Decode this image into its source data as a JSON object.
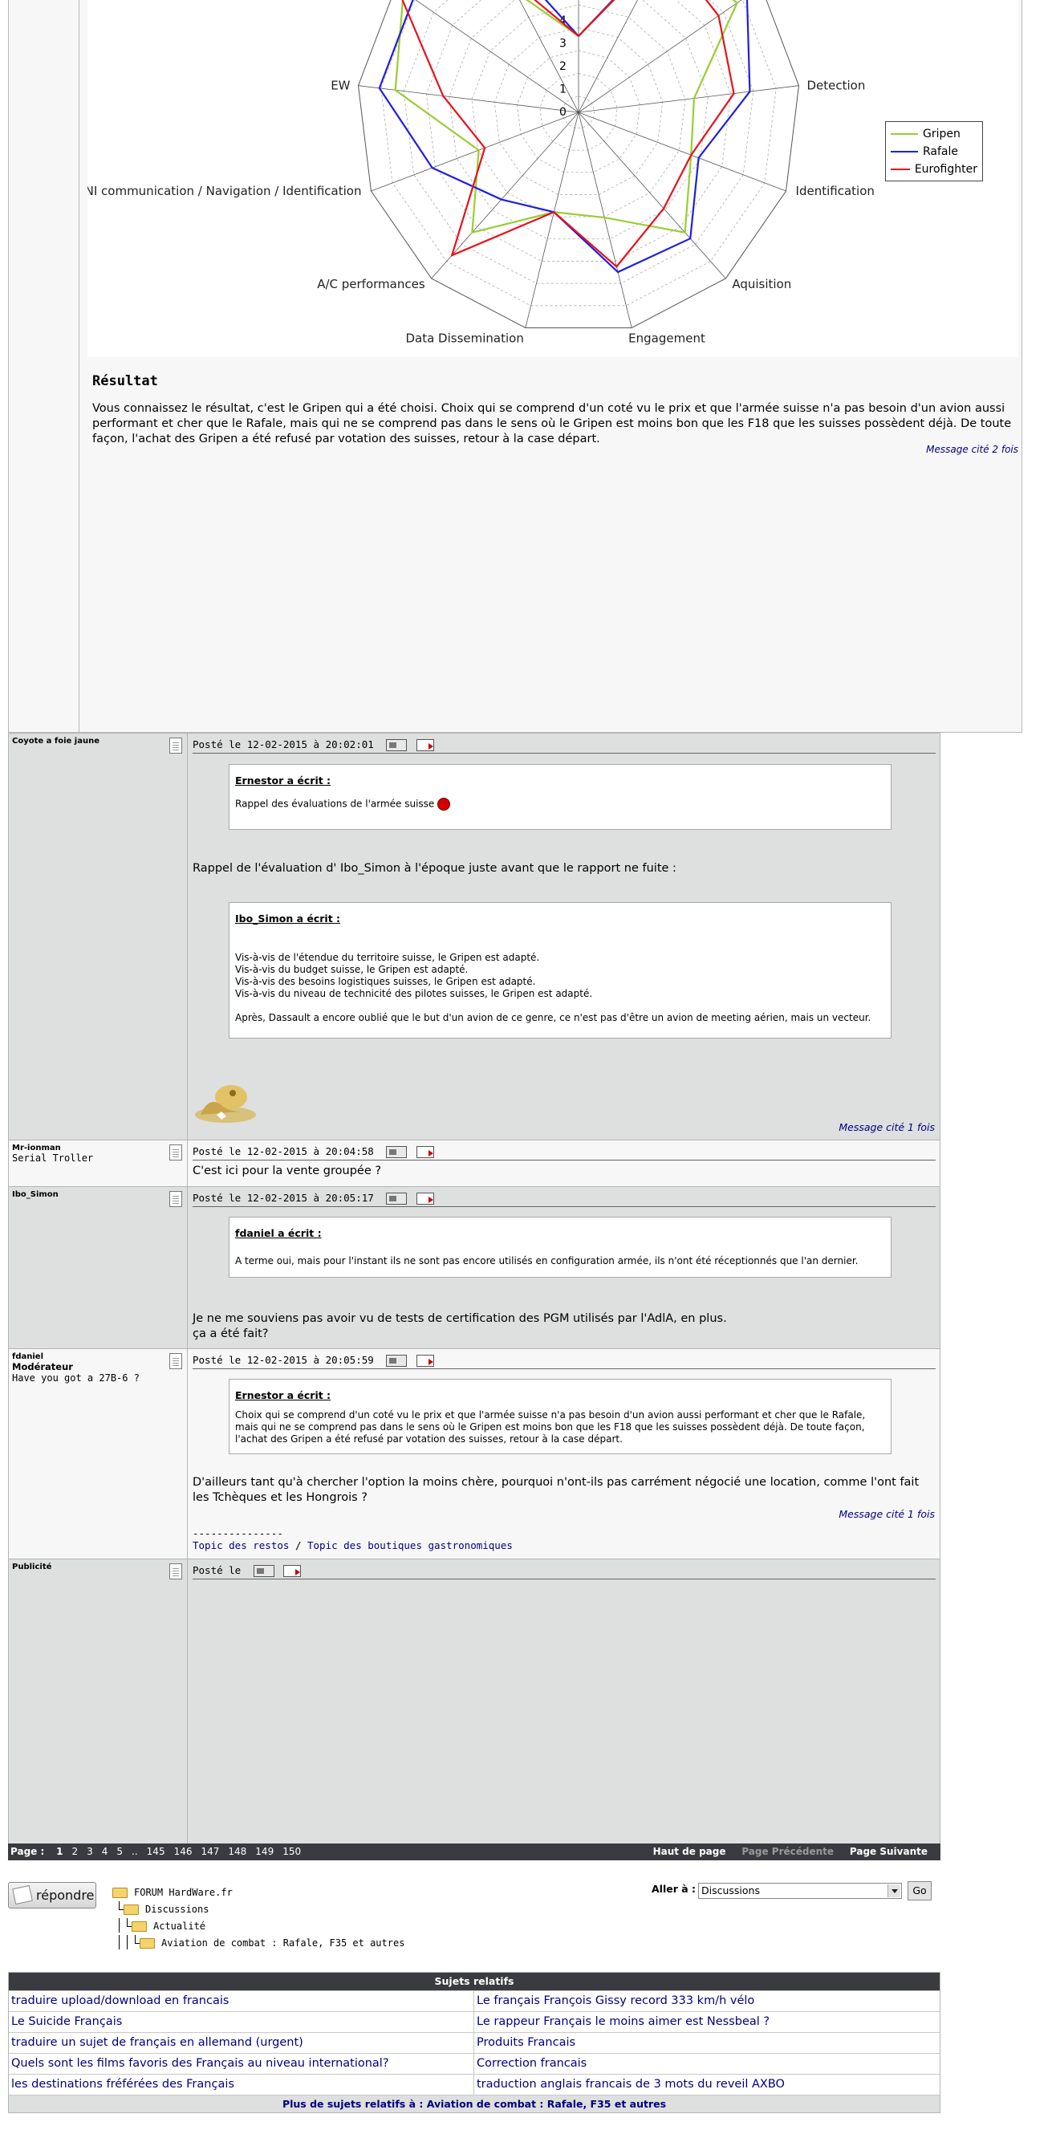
{
  "colors": {
    "gripen": "#9acd32",
    "rafale": "#1f1fdd",
    "eurofighter": "#e8121a",
    "bar_dark": "#393b40",
    "link": "#000080"
  },
  "chart_data": {
    "type": "radar",
    "axes": [
      "Detection",
      "Identification",
      "Aquisition",
      "Engagement",
      "Data Dissemination",
      "A/C performances",
      "CNI communication / Navigation / Identification",
      "EW"
    ],
    "tick_labels": [
      "0",
      "1",
      "2",
      "3",
      "4"
    ],
    "series": [
      {
        "name": "Gripen"
      },
      {
        "name": "Rafale"
      },
      {
        "name": "Eurofighter"
      }
    ]
  },
  "top_post": {
    "result_title": "Résultat",
    "result_text": "Vous connaissez le résultat, c'est le Gripen qui a été choisi. Choix qui se comprend d'un coté vu le prix et que l'armée suisse n'a pas besoin d'un avion aussi performant et cher que le Rafale, mais qui ne se comprend pas dans le sens où le Gripen est moins bon que les F18 que les suisses possèdent déjà. De toute façon, l'achat des Gripen a été refusé par votation des suisses, retour à la case départ.",
    "cited": "Message cité 2 fois"
  },
  "posts": [
    {
      "author": "Coyote a foie jaune",
      "date": "Posté le 12-02-2015 à 20:02:01",
      "quote1_title": "Ernestor a écrit :",
      "quote1_text": "Rappel des évaluations de l'armée suisse",
      "text": "Rappel de l'évaluation d' Ibo_Simon à l'époque juste avant que le rapport ne fuite :",
      "quote2_title": "Ibo_Simon a écrit :",
      "quote2_lines": [
        "Vis-à-vis de l'étendue du territoire suisse, le Gripen est adapté.",
        "Vis-à-vis du budget suisse, le Gripen est adapté.",
        "Vis-à-vis des besoins logistiques suisses, le Gripen est adapté.",
        "Vis-à-vis du niveau de technicité des pilotes suisses, le Gripen est adapté.",
        "",
        "Après, Dassault a encore oublié que le but d'un avion de ce genre, ce n'est pas d'être un avion de meeting aérien, mais un vecteur."
      ],
      "cited": "Message cité 1 fois"
    },
    {
      "author": "Mr-ionman",
      "title": "Serial Troller",
      "date": "Posté le 12-02-2015 à 20:04:58",
      "text": "C'est ici pour la vente groupée ?"
    },
    {
      "author": "Ibo_Simon",
      "date": "Posté le 12-02-2015 à 20:05:17",
      "quote_title": "fdaniel a écrit :",
      "quote_text": "A terme oui, mais pour l'instant ils ne sont pas encore utilisés en configuration armée, ils n'ont été réceptionnés que l'an dernier.",
      "text_line1": "Je ne me souviens pas avoir vu de tests de certification des PGM utilisés par l'AdlA, en plus.",
      "text_line2": "ça a été fait?"
    },
    {
      "author": "fdaniel",
      "rank": "Modérateur",
      "title": "Have you got a 27B-6 ?",
      "date": "Posté le 12-02-2015 à 20:05:59",
      "quote_title": "Ernestor a écrit :",
      "quote_text": "Choix qui se comprend d'un coté vu le prix et que l'armée suisse n'a pas besoin d'un avion aussi performant et cher que le Rafale, mais qui ne se comprend pas dans le sens où le Gripen est moins bon que les F18 que les suisses possèdent déjà. De toute façon, l'achat des Gripen a été refusé par votation des suisses, retour à la case départ.",
      "text": "D'ailleurs tant qu'à chercher l'option la moins chère, pourquoi n'ont-ils pas carrément négocié une location, comme l'ont fait les Tchèques et les Hongrois ?",
      "cited": "Message cité 1 fois",
      "sig_sep": "---------------",
      "sig_link1": "Topic des restos",
      "sig_slash": " / ",
      "sig_link2": "Topic des boutiques gastronomiques"
    },
    {
      "author": "Publicité",
      "date": "Posté le"
    }
  ],
  "pager": {
    "label": "Page :",
    "pages": [
      "1",
      "2",
      "3",
      "4",
      "5",
      "..",
      "145",
      "146",
      "147",
      "148",
      "149",
      "150"
    ],
    "current": "1",
    "top_link": "Haut de page",
    "prev_link": "Page Précédente",
    "next_link": "Page Suivante"
  },
  "reply_label": "répondre",
  "breadcrumb": [
    "FORUM HardWare.fr",
    "Discussions",
    "Actualité",
    "Aviation de combat : Rafale, F35 et autres"
  ],
  "goto": {
    "label": "Aller à :",
    "value": "Discussions",
    "button": "Go"
  },
  "related": {
    "header": "Sujets relatifs",
    "items": [
      "traduire upload/download en francais",
      "Le français François Gissy record 333 km/h vélo",
      "Le Suicide Français",
      "Le rappeur Français le moins aimer est Nessbeal ?",
      "traduire un sujet de français en allemand (urgent)",
      "Produits Francais",
      "Quels sont les films favoris des Français au niveau international?",
      "Correction francais",
      "les destinations fréférées des Français",
      "traduction anglais francais de 3 mots du reveil AXBO"
    ],
    "footer": "Plus de sujets relatifs à : Aviation de combat : Rafale, F35 et autres"
  }
}
